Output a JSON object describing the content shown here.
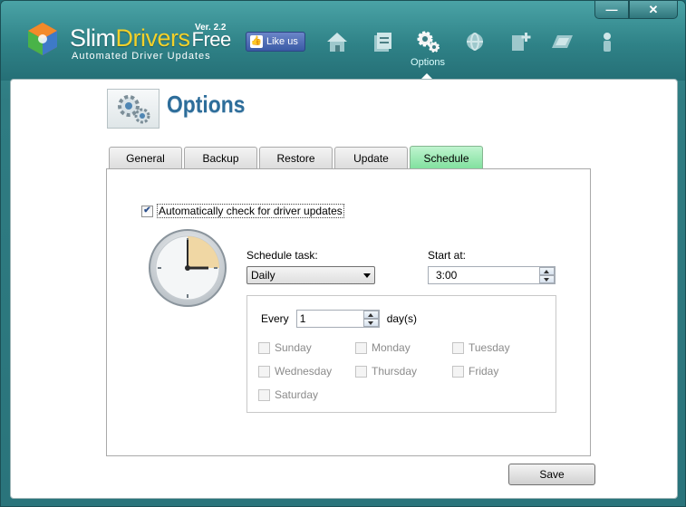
{
  "app": {
    "brand_main": "Slim",
    "brand_accent": "Drivers",
    "brand_free": "Free",
    "version": "Ver. 2.2",
    "tagline": "Automated Driver Updates",
    "like_label": "Like us"
  },
  "nav": {
    "items": [
      {
        "icon": "home-icon"
      },
      {
        "icon": "scan-icon"
      },
      {
        "icon": "options-gear-icon",
        "label": "Options",
        "active": true
      },
      {
        "icon": "network-icon"
      },
      {
        "icon": "backup-icon"
      },
      {
        "icon": "restore-icon"
      },
      {
        "icon": "user-icon"
      }
    ],
    "active_label": "Options"
  },
  "window_controls": {
    "minimize": "—",
    "close": "✕"
  },
  "page": {
    "title": "Options"
  },
  "tabs": [
    {
      "label": "General"
    },
    {
      "label": "Backup"
    },
    {
      "label": "Restore"
    },
    {
      "label": "Update"
    },
    {
      "label": "Schedule",
      "active": true
    }
  ],
  "schedule": {
    "auto_check_label": "Automatically check for driver updates",
    "auto_check_checked": true,
    "schedule_task_label": "Schedule task:",
    "schedule_task_value": "Daily",
    "start_at_label": "Start at:",
    "start_at_value": "3:00",
    "every_label": "Every",
    "every_value": "1",
    "every_unit": "day(s)",
    "days": [
      {
        "label": "Sunday",
        "checked": false
      },
      {
        "label": "Monday",
        "checked": false
      },
      {
        "label": "Tuesday",
        "checked": false
      },
      {
        "label": "Wednesday",
        "checked": false
      },
      {
        "label": "Thursday",
        "checked": false
      },
      {
        "label": "Friday",
        "checked": false
      },
      {
        "label": "Saturday",
        "checked": false
      }
    ]
  },
  "footer": {
    "save_label": "Save"
  },
  "colors": {
    "header_teal": "#2f8287",
    "active_tab_green": "#7fe09d",
    "title_blue": "#2d6d9a",
    "brand_accent": "#f3d12a"
  }
}
